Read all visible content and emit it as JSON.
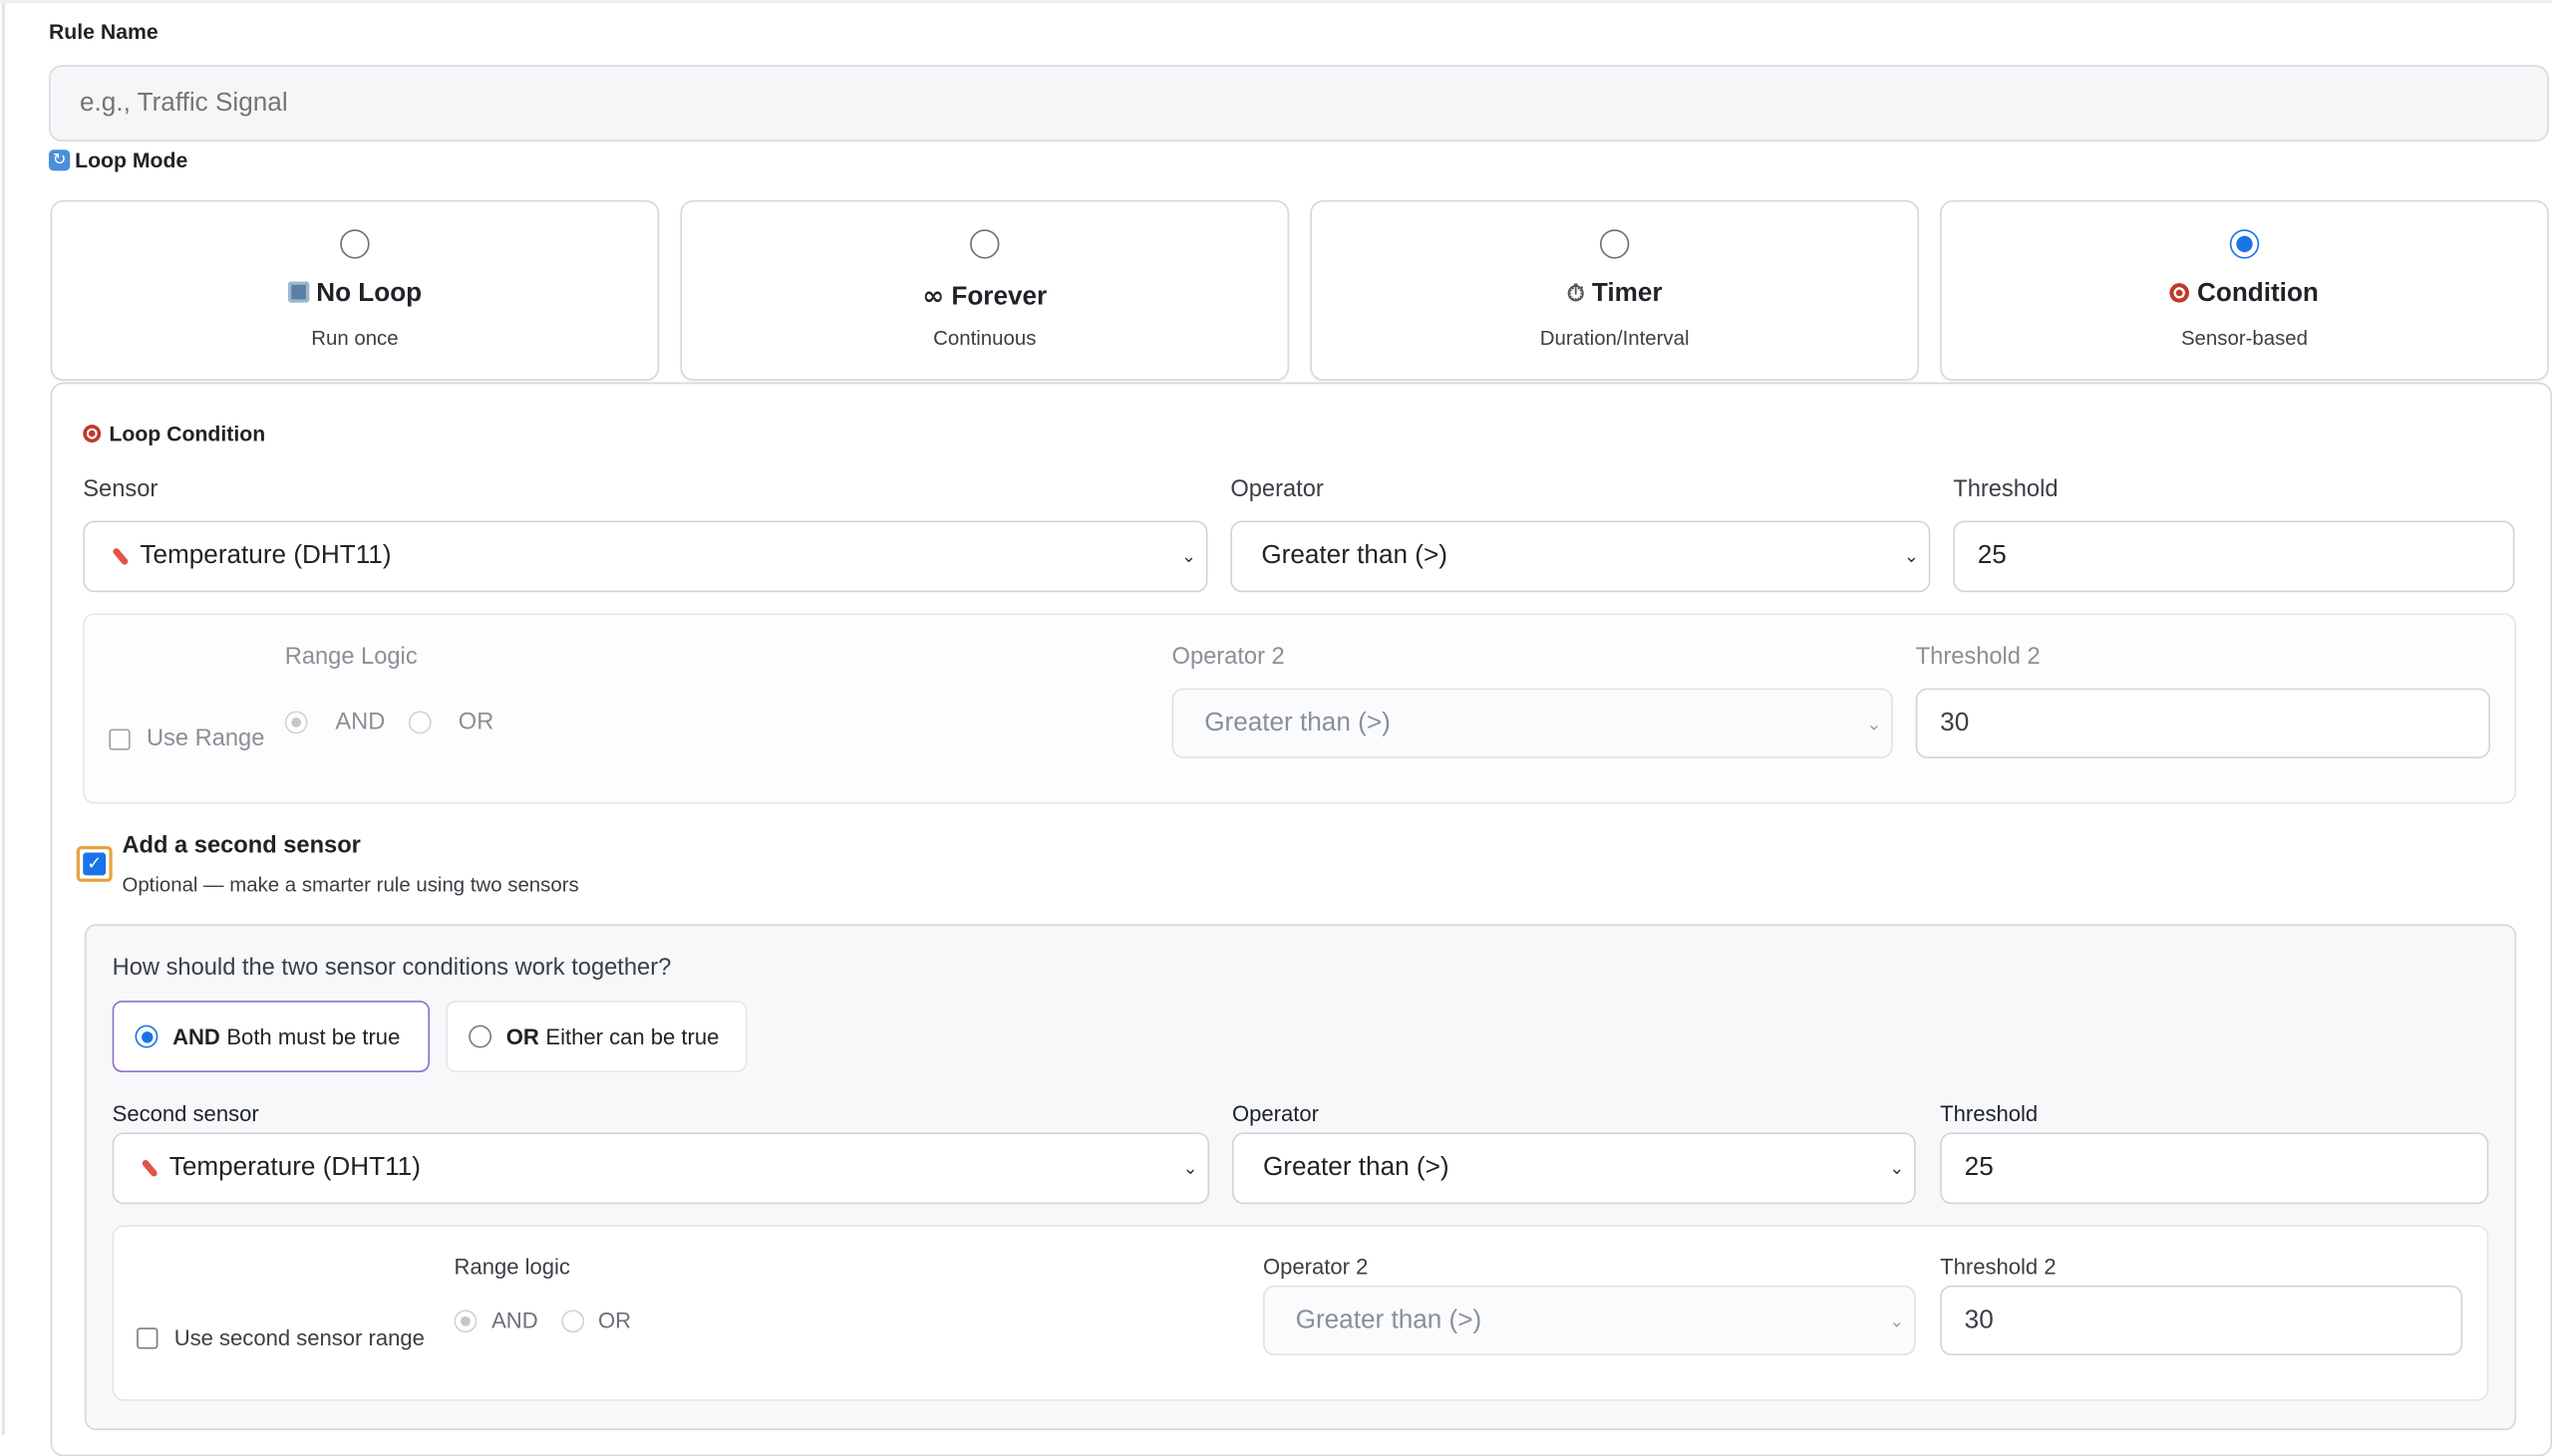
{
  "rule_name": {
    "label": "Rule Name",
    "placeholder": "e.g., Traffic Signal"
  },
  "loop_mode": {
    "label": "Loop Mode",
    "options": [
      {
        "title": "No Loop",
        "subtitle": "Run once",
        "selected": false
      },
      {
        "title": "Forever",
        "subtitle": "Continuous",
        "selected": false
      },
      {
        "title": "Timer",
        "subtitle": "Duration/Interval",
        "selected": false
      },
      {
        "title": "Condition",
        "subtitle": "Sensor-based",
        "selected": true
      }
    ]
  },
  "loop_condition": {
    "title": "Loop Condition",
    "sensor_label": "Sensor",
    "sensor_value": "Temperature (DHT11)",
    "operator_label": "Operator",
    "operator_value": "Greater than (>)",
    "threshold_label": "Threshold",
    "threshold_value": "25",
    "range": {
      "use_range_label": "Use Range",
      "range_logic_label": "Range Logic",
      "and_label": "AND",
      "or_label": "OR",
      "operator2_label": "Operator 2",
      "operator2_value": "Greater than (>)",
      "threshold2_label": "Threshold 2",
      "threshold2_value": "30"
    }
  },
  "second_sensor": {
    "checkbox_label": "Add a second sensor",
    "checkbox_help": "Optional — make a smarter rule using two sensors",
    "combine_question": "How should the two sensor conditions work together?",
    "combine_and_key": "AND",
    "combine_and_text": "Both must be true",
    "combine_or_key": "OR",
    "combine_or_text": "Either can be true",
    "sensor_label": "Second sensor",
    "sensor_value": "Temperature (DHT11)",
    "operator_label": "Operator",
    "operator_value": "Greater than (>)",
    "threshold_label": "Threshold",
    "threshold_value": "25",
    "range": {
      "use_range_label": "Use second sensor range",
      "range_logic_label": "Range logic",
      "and_label": "AND",
      "or_label": "OR",
      "operator2_label": "Operator 2",
      "operator2_value": "Greater than (>)",
      "threshold2_label": "Threshold 2",
      "threshold2_value": "30"
    }
  },
  "colors": {
    "accent": "#1a73e8",
    "focus_outline": "#e8a33d",
    "and_option_border": "#8e6fc9"
  }
}
